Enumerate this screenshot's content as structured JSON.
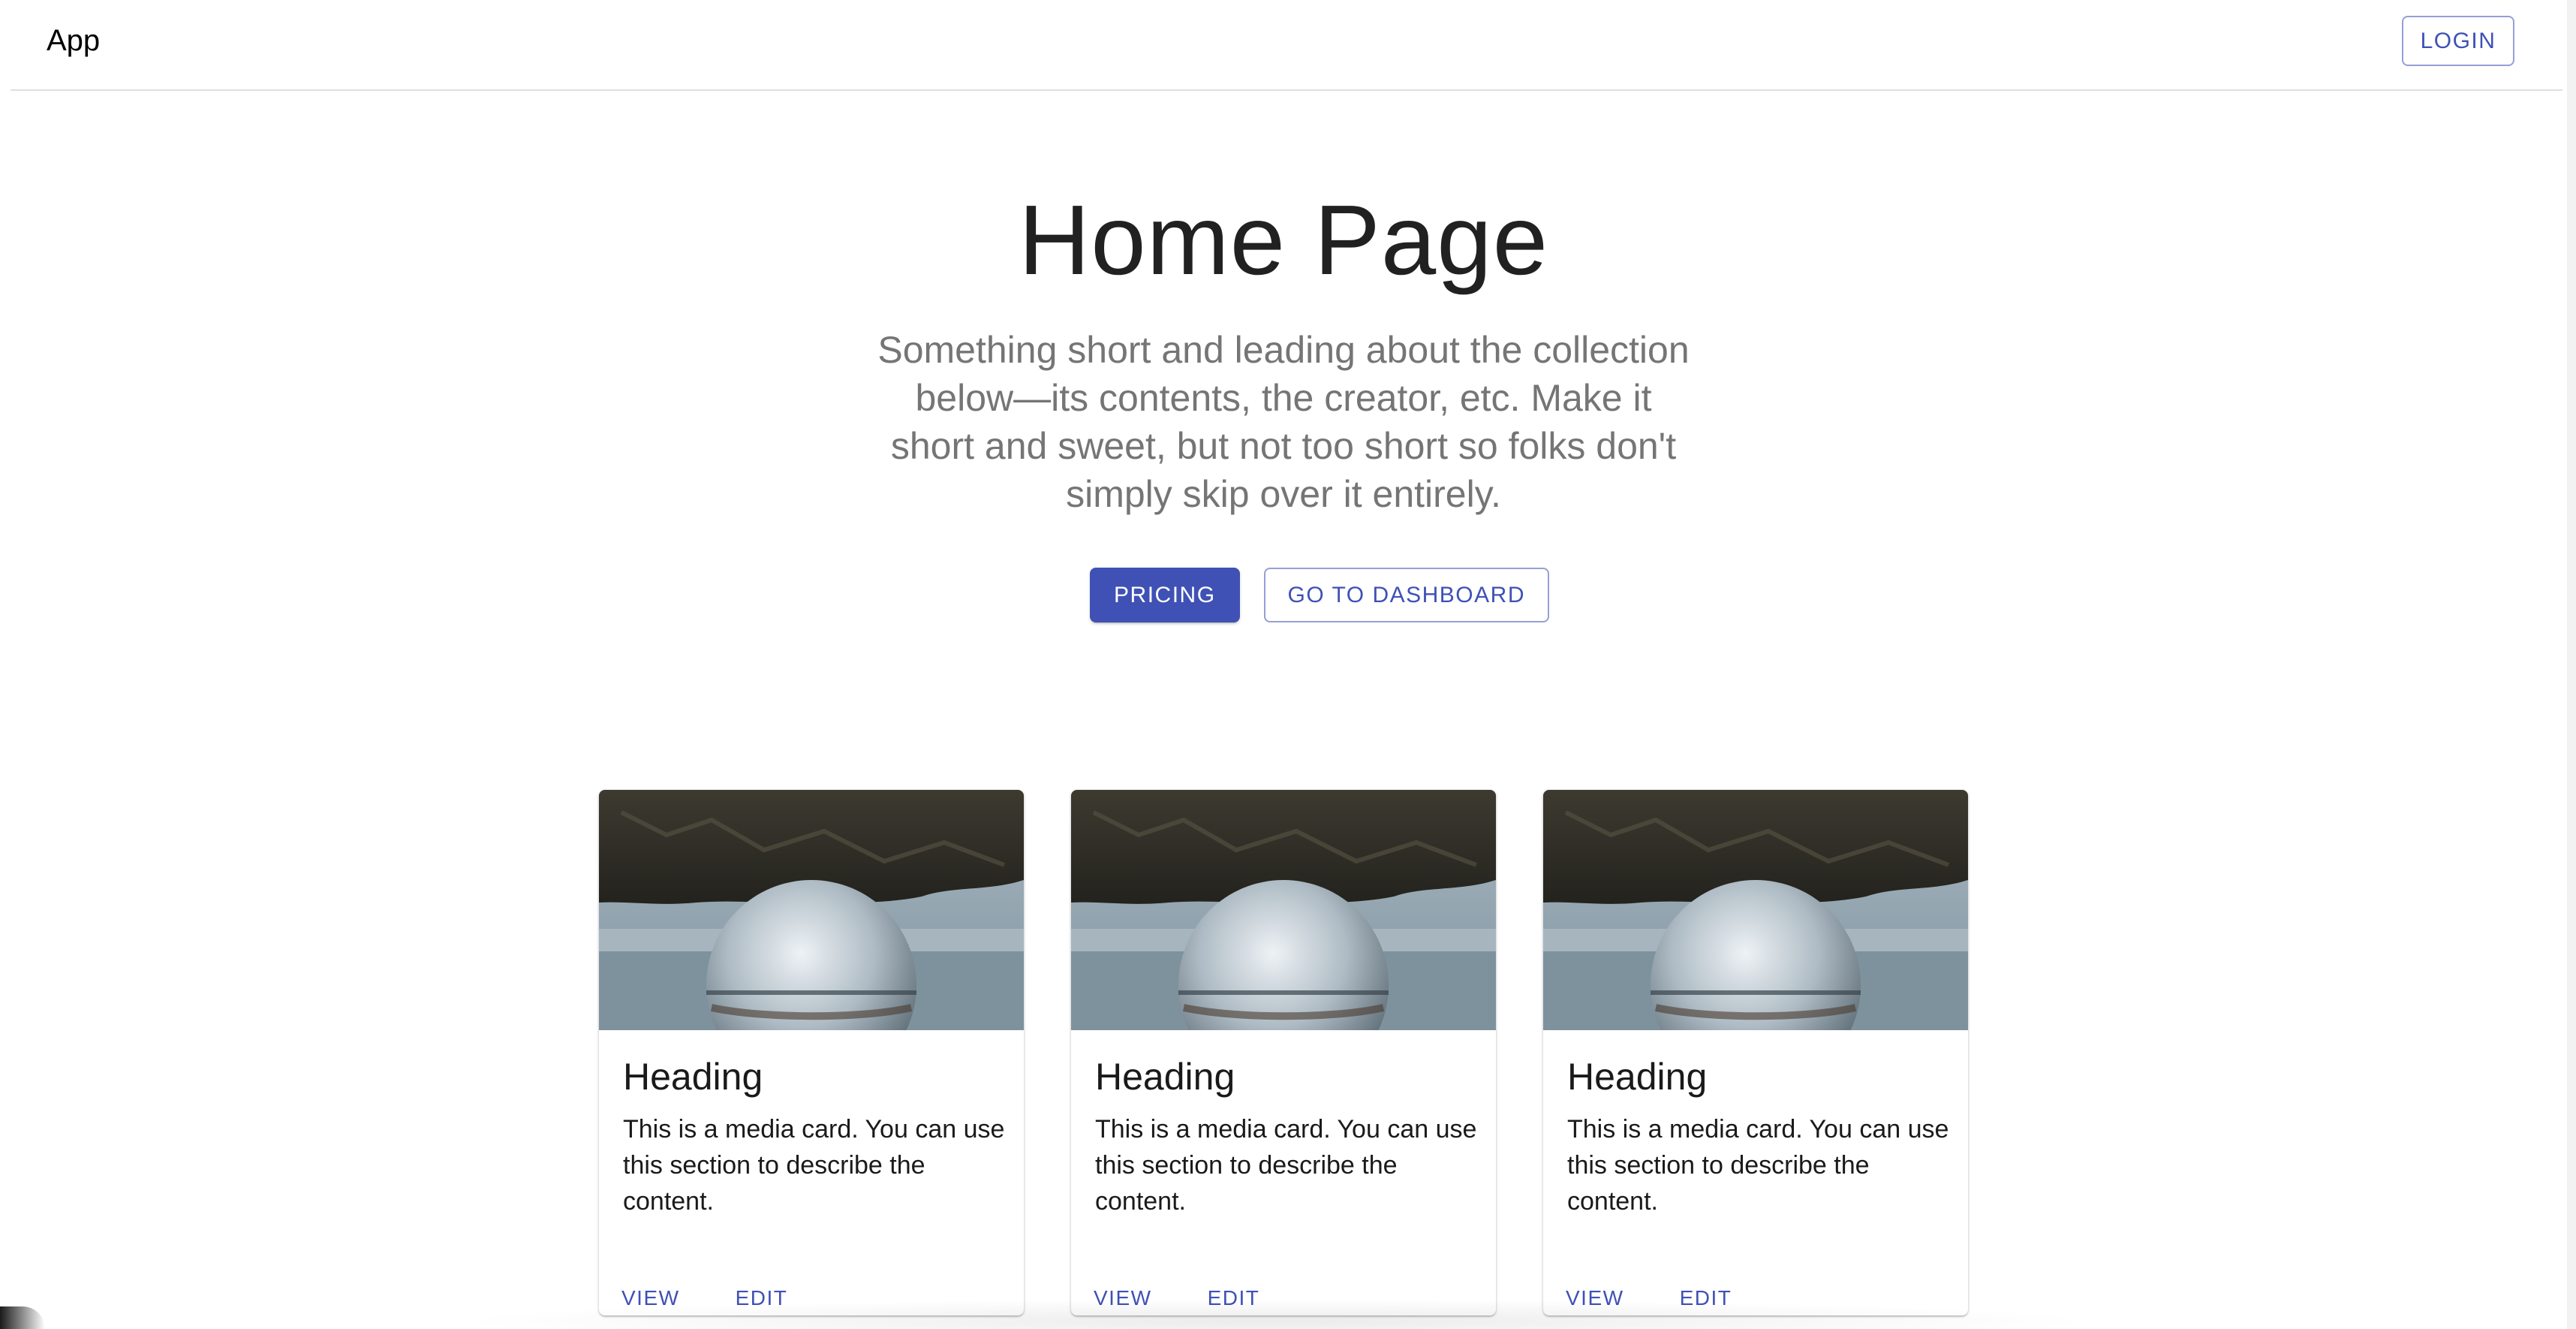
{
  "appbar": {
    "brand": "App",
    "login_label": "LOGIN"
  },
  "hero": {
    "title": "Home Page",
    "subtitle": "Something short and leading about the collection below—its contents, the creator, etc. Make it short and sweet, but not too short so folks don't simply skip over it entirely.",
    "primary_label": "PRICING",
    "secondary_label": "GO TO DASHBOARD"
  },
  "cards": [
    {
      "heading": "Heading",
      "text": "This is a media card. You can use this section to describe the content.",
      "view_label": "VIEW",
      "edit_label": "EDIT"
    },
    {
      "heading": "Heading",
      "text": "This is a media card. You can use this section to describe the content.",
      "view_label": "VIEW",
      "edit_label": "EDIT"
    },
    {
      "heading": "Heading",
      "text": "This is a media card. You can use this section to describe the content.",
      "view_label": "VIEW",
      "edit_label": "EDIT"
    }
  ],
  "colors": {
    "primary": "#3f51b5",
    "subtitle_gray": "#757575",
    "divider": "#e0e0e0"
  }
}
